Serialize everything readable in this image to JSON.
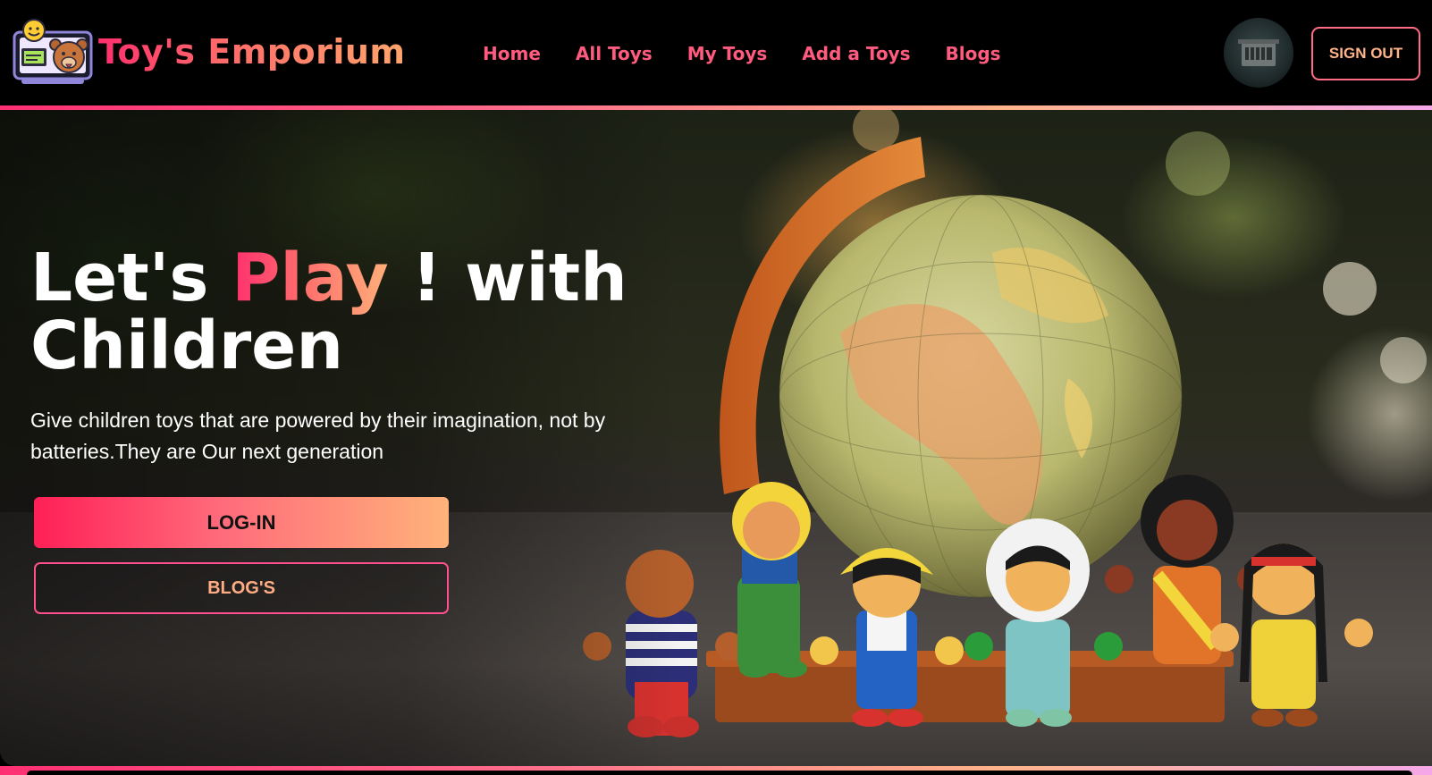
{
  "brand": {
    "name": "Toy's Emporium",
    "logo_icon": "toy-laptop-bear-icon"
  },
  "nav": {
    "items": [
      {
        "label": "Home"
      },
      {
        "label": "All Toys"
      },
      {
        "label": "My Toys"
      },
      {
        "label": "Add a Toys"
      },
      {
        "label": "Blogs"
      }
    ]
  },
  "user": {
    "avatar_icon": "user-avatar-photo",
    "signout_label": "SIGN OUT"
  },
  "hero": {
    "headline_part1": "Let's ",
    "headline_accent": "Play",
    "headline_part2": " ! with Children",
    "subtitle": "Give children toys that are powered by their imagination, not by batteries.They are Our next generation",
    "login_label": "LOG-IN",
    "blogs_label": "BLOG'S",
    "image_subject": "globe-with-wooden-doll-toys"
  },
  "colors": {
    "accent_pink": "#ff2f6e",
    "accent_orange": "#ffa56b",
    "nav_link": "#ff5b7e",
    "background": "#000000"
  }
}
